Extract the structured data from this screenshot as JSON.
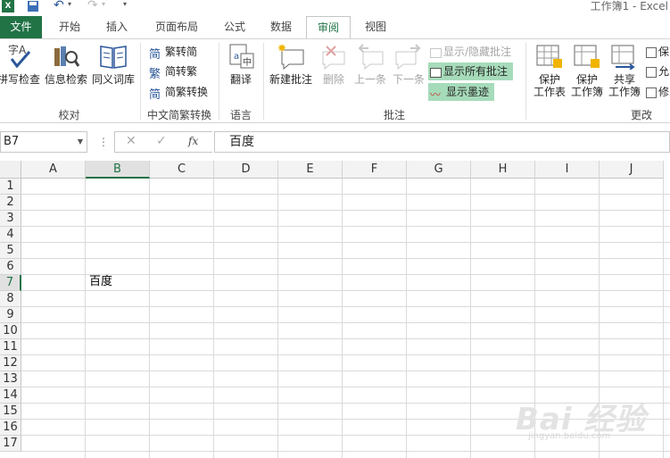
{
  "title_bar": {
    "window_title": "工作簿1 - Excel"
  },
  "tabs": [
    {
      "label": "文件"
    },
    {
      "label": "开始"
    },
    {
      "label": "插入"
    },
    {
      "label": "页面布局"
    },
    {
      "label": "公式"
    },
    {
      "label": "数据"
    },
    {
      "label": "审阅"
    },
    {
      "label": "视图"
    }
  ],
  "active_tab": "审阅",
  "ribbon": {
    "proofing": {
      "label": "校对",
      "spell_check": "拼写检查",
      "research": "信息检索",
      "thesaurus": "同义词库"
    },
    "chinese_conversion": {
      "label": "中文简繁转换",
      "to_simplified_icon_char": "简",
      "to_simplified": "繁转简",
      "to_traditional_icon_char": "繁",
      "to_traditional": "简转繁",
      "convert_icon_char": "简",
      "convert": "简繁转换"
    },
    "language": {
      "label": "语言",
      "translate": "翻译"
    },
    "comments": {
      "label": "批注",
      "new_comment": "新建批注",
      "delete": "删除",
      "previous": "上一条",
      "next": "下一条",
      "show_hide": "显示/隐藏批注",
      "show_all": "显示所有批注",
      "show_ink": "显示墨迹"
    },
    "changes": {
      "label": "更改",
      "protect_sheet_line1": "保护",
      "protect_sheet_line2": "工作表",
      "protect_workbook_line1": "保护",
      "protect_workbook_line2": "工作簿",
      "share_workbook_line1": "共享",
      "share_workbook_line2": "工作簿",
      "protect_share": "保",
      "allow_edit": "允",
      "track_changes": "修"
    }
  },
  "formula_bar": {
    "name_box": "B7",
    "fx": "fx",
    "content": "百度"
  },
  "grid": {
    "columns": [
      "A",
      "B",
      "C",
      "D",
      "E",
      "F",
      "G",
      "H",
      "I",
      "J"
    ],
    "rows": [
      "1",
      "2",
      "3",
      "4",
      "5",
      "6",
      "7",
      "8",
      "9",
      "10",
      "11",
      "12",
      "13",
      "14",
      "15",
      "16",
      "17"
    ],
    "selected_column": "B",
    "selected_row": "7",
    "cells": {
      "B7": "百度"
    }
  },
  "watermark": {
    "text": "Bai 经验",
    "sub": "jingyan.baidu.com"
  },
  "colors": {
    "excel_green": "#217346",
    "active_button_bg": "#a6dbba"
  }
}
